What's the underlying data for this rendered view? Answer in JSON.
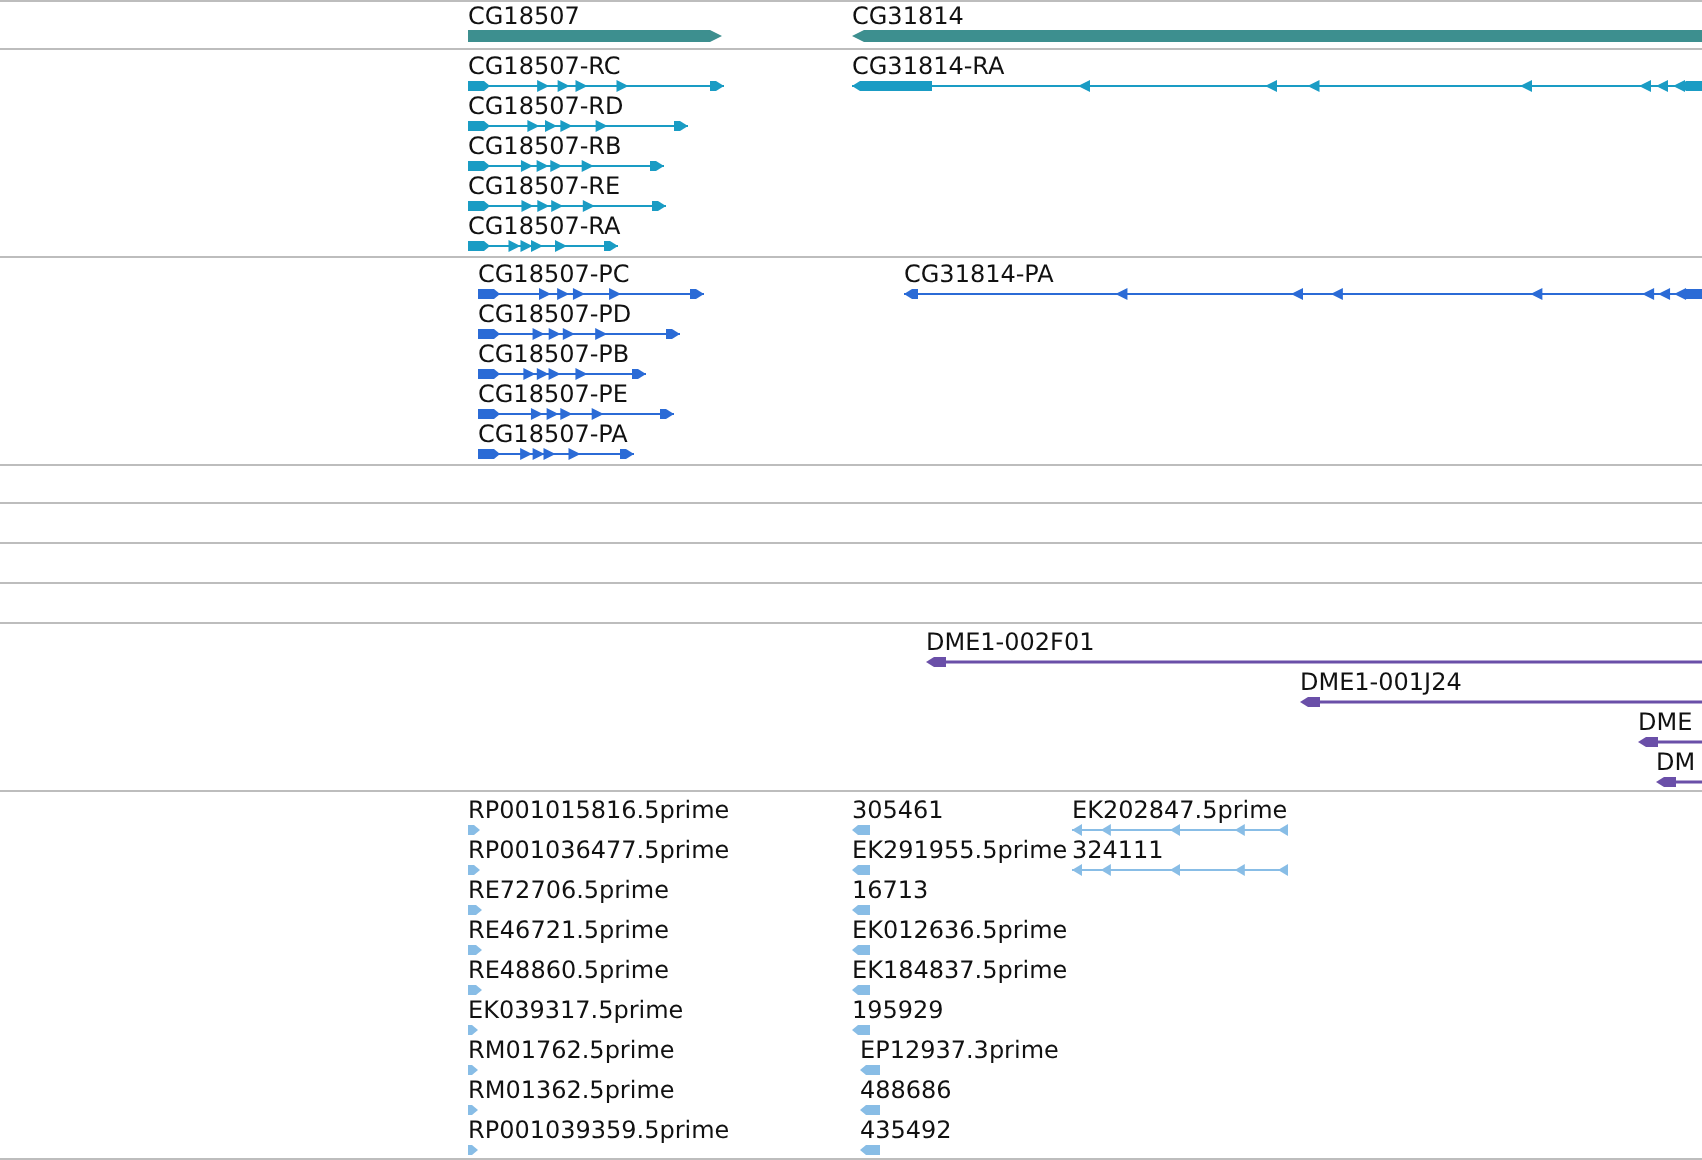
{
  "tracks": [
    {
      "kind": "genes",
      "features": [
        {
          "label": "CG18507",
          "reverse": false
        },
        {
          "label": "CG31814",
          "reverse": true
        }
      ]
    },
    {
      "kind": "transcripts",
      "features": [
        {
          "label": "CG18507-RC",
          "reverse": false
        },
        {
          "label": "CG18507-RD",
          "reverse": false
        },
        {
          "label": "CG18507-RB",
          "reverse": false
        },
        {
          "label": "CG18507-RE",
          "reverse": false
        },
        {
          "label": "CG18507-RA",
          "reverse": false
        },
        {
          "label": "CG31814-RA",
          "reverse": true
        }
      ]
    },
    {
      "kind": "proteins",
      "features": [
        {
          "label": "CG18507-PC",
          "reverse": false
        },
        {
          "label": "CG18507-PD",
          "reverse": false
        },
        {
          "label": "CG18507-PB",
          "reverse": false
        },
        {
          "label": "CG18507-PE",
          "reverse": false
        },
        {
          "label": "CG18507-PA",
          "reverse": false
        },
        {
          "label": "CG31814-PA",
          "reverse": true
        }
      ]
    },
    {
      "kind": "clones",
      "features": [
        {
          "label": "DME1-002F01",
          "reverse": true
        },
        {
          "label": "DME1-001J24",
          "reverse": true
        },
        {
          "label": "DME",
          "reverse": true
        },
        {
          "label": "DM",
          "reverse": true
        }
      ]
    },
    {
      "kind": "ests",
      "features": [
        {
          "label": "RP001015816.5prime",
          "reverse": false
        },
        {
          "label": "305461",
          "reverse": true
        },
        {
          "label": "EK202847.5prime",
          "reverse": true
        },
        {
          "label": "RP001036477.5prime",
          "reverse": false
        },
        {
          "label": "EK291955.5prime",
          "reverse": true
        },
        {
          "label": "324111",
          "reverse": true
        },
        {
          "label": "RE72706.5prime",
          "reverse": false
        },
        {
          "label": "16713",
          "reverse": true
        },
        {
          "label": "RE46721.5prime",
          "reverse": false
        },
        {
          "label": "EK012636.5prime",
          "reverse": true
        },
        {
          "label": "RE48860.5prime",
          "reverse": false
        },
        {
          "label": "EK184837.5prime",
          "reverse": true
        },
        {
          "label": "EK039317.5prime",
          "reverse": false
        },
        {
          "label": "195929",
          "reverse": true
        },
        {
          "label": "RM01762.5prime",
          "reverse": false
        },
        {
          "label": "EP12937.3prime",
          "reverse": true
        },
        {
          "label": "RM01362.5prime",
          "reverse": false
        },
        {
          "label": "488686",
          "reverse": true
        },
        {
          "label": "RP001039359.5prime",
          "reverse": false
        },
        {
          "label": "435492",
          "reverse": true
        }
      ]
    }
  ]
}
